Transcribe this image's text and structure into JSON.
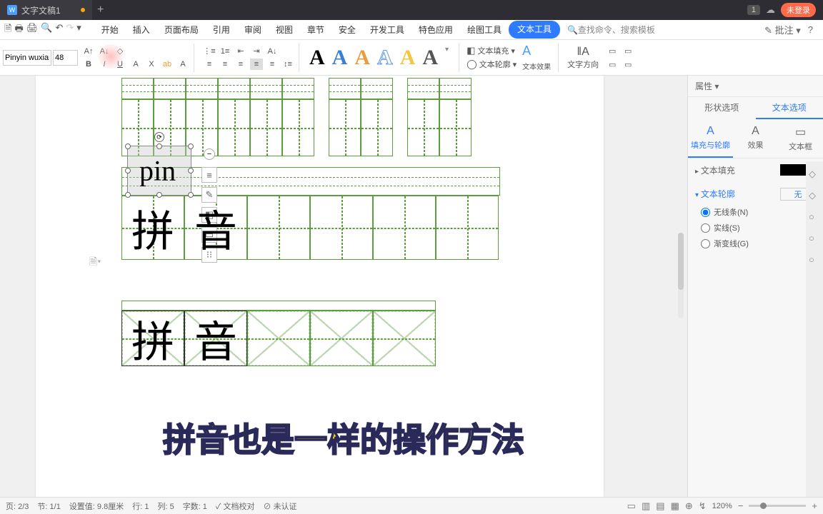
{
  "titlebar": {
    "doc_title": "文字文稿1",
    "badge": "1",
    "login": "未登录"
  },
  "menu": {
    "items": [
      "开始",
      "插入",
      "页面布局",
      "引用",
      "审阅",
      "视图",
      "章节",
      "安全",
      "开发工具",
      "特色应用",
      "绘图工具",
      "文本工具"
    ],
    "active_index": 11,
    "search_placeholder": "查找命令、搜索模板",
    "annotate": "批注"
  },
  "ribbon": {
    "font_name": "Pinyin wuxian",
    "font_size": "48",
    "styles_colors": [
      "#000",
      "#3a7fd6",
      "#e89c3c",
      "#5c9add",
      "#f4c542",
      "#555"
    ],
    "text_fill": "文本填充",
    "text_outline": "文本轮廓",
    "text_effect": "文本效果",
    "text_direction": "文字方向"
  },
  "canvas": {
    "pin_text": "pin",
    "char1": "拼",
    "char2": "音"
  },
  "subtitle": "拼音也是一样的操作方法",
  "panel": {
    "header": "属性",
    "tab_shape": "形状选项",
    "tab_text": "文本选项",
    "sub_fill": "填充与轮廓",
    "sub_effect": "效果",
    "sub_box": "文本框",
    "sec_fill": "文本填充",
    "sec_outline": "文本轮廓",
    "outline_val": "无",
    "radio_none": "无线条(N)",
    "radio_solid": "实线(S)",
    "radio_gradient": "渐变线(G)"
  },
  "status": {
    "page": "页: 2/3",
    "section": "节: 1/1",
    "pos": "设置值: 9.8厘米",
    "line": "行: 1",
    "col": "列: 5",
    "chars": "字数: 1",
    "proof": "文档校对",
    "cert": "未认证",
    "zoom": "120%"
  }
}
